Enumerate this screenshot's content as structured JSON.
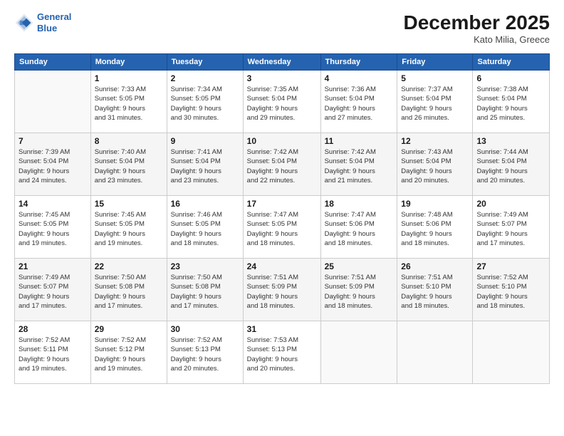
{
  "logo": {
    "line1": "General",
    "line2": "Blue"
  },
  "title": "December 2025",
  "subtitle": "Kato Milia, Greece",
  "header_days": [
    "Sunday",
    "Monday",
    "Tuesday",
    "Wednesday",
    "Thursday",
    "Friday",
    "Saturday"
  ],
  "weeks": [
    [
      {
        "day": "",
        "info": ""
      },
      {
        "day": "1",
        "info": "Sunrise: 7:33 AM\nSunset: 5:05 PM\nDaylight: 9 hours\nand 31 minutes."
      },
      {
        "day": "2",
        "info": "Sunrise: 7:34 AM\nSunset: 5:05 PM\nDaylight: 9 hours\nand 30 minutes."
      },
      {
        "day": "3",
        "info": "Sunrise: 7:35 AM\nSunset: 5:04 PM\nDaylight: 9 hours\nand 29 minutes."
      },
      {
        "day": "4",
        "info": "Sunrise: 7:36 AM\nSunset: 5:04 PM\nDaylight: 9 hours\nand 27 minutes."
      },
      {
        "day": "5",
        "info": "Sunrise: 7:37 AM\nSunset: 5:04 PM\nDaylight: 9 hours\nand 26 minutes."
      },
      {
        "day": "6",
        "info": "Sunrise: 7:38 AM\nSunset: 5:04 PM\nDaylight: 9 hours\nand 25 minutes."
      }
    ],
    [
      {
        "day": "7",
        "info": "Sunrise: 7:39 AM\nSunset: 5:04 PM\nDaylight: 9 hours\nand 24 minutes."
      },
      {
        "day": "8",
        "info": "Sunrise: 7:40 AM\nSunset: 5:04 PM\nDaylight: 9 hours\nand 23 minutes."
      },
      {
        "day": "9",
        "info": "Sunrise: 7:41 AM\nSunset: 5:04 PM\nDaylight: 9 hours\nand 23 minutes."
      },
      {
        "day": "10",
        "info": "Sunrise: 7:42 AM\nSunset: 5:04 PM\nDaylight: 9 hours\nand 22 minutes."
      },
      {
        "day": "11",
        "info": "Sunrise: 7:42 AM\nSunset: 5:04 PM\nDaylight: 9 hours\nand 21 minutes."
      },
      {
        "day": "12",
        "info": "Sunrise: 7:43 AM\nSunset: 5:04 PM\nDaylight: 9 hours\nand 20 minutes."
      },
      {
        "day": "13",
        "info": "Sunrise: 7:44 AM\nSunset: 5:04 PM\nDaylight: 9 hours\nand 20 minutes."
      }
    ],
    [
      {
        "day": "14",
        "info": "Sunrise: 7:45 AM\nSunset: 5:05 PM\nDaylight: 9 hours\nand 19 minutes."
      },
      {
        "day": "15",
        "info": "Sunrise: 7:45 AM\nSunset: 5:05 PM\nDaylight: 9 hours\nand 19 minutes."
      },
      {
        "day": "16",
        "info": "Sunrise: 7:46 AM\nSunset: 5:05 PM\nDaylight: 9 hours\nand 18 minutes."
      },
      {
        "day": "17",
        "info": "Sunrise: 7:47 AM\nSunset: 5:05 PM\nDaylight: 9 hours\nand 18 minutes."
      },
      {
        "day": "18",
        "info": "Sunrise: 7:47 AM\nSunset: 5:06 PM\nDaylight: 9 hours\nand 18 minutes."
      },
      {
        "day": "19",
        "info": "Sunrise: 7:48 AM\nSunset: 5:06 PM\nDaylight: 9 hours\nand 18 minutes."
      },
      {
        "day": "20",
        "info": "Sunrise: 7:49 AM\nSunset: 5:07 PM\nDaylight: 9 hours\nand 17 minutes."
      }
    ],
    [
      {
        "day": "21",
        "info": "Sunrise: 7:49 AM\nSunset: 5:07 PM\nDaylight: 9 hours\nand 17 minutes."
      },
      {
        "day": "22",
        "info": "Sunrise: 7:50 AM\nSunset: 5:08 PM\nDaylight: 9 hours\nand 17 minutes."
      },
      {
        "day": "23",
        "info": "Sunrise: 7:50 AM\nSunset: 5:08 PM\nDaylight: 9 hours\nand 17 minutes."
      },
      {
        "day": "24",
        "info": "Sunrise: 7:51 AM\nSunset: 5:09 PM\nDaylight: 9 hours\nand 18 minutes."
      },
      {
        "day": "25",
        "info": "Sunrise: 7:51 AM\nSunset: 5:09 PM\nDaylight: 9 hours\nand 18 minutes."
      },
      {
        "day": "26",
        "info": "Sunrise: 7:51 AM\nSunset: 5:10 PM\nDaylight: 9 hours\nand 18 minutes."
      },
      {
        "day": "27",
        "info": "Sunrise: 7:52 AM\nSunset: 5:10 PM\nDaylight: 9 hours\nand 18 minutes."
      }
    ],
    [
      {
        "day": "28",
        "info": "Sunrise: 7:52 AM\nSunset: 5:11 PM\nDaylight: 9 hours\nand 19 minutes."
      },
      {
        "day": "29",
        "info": "Sunrise: 7:52 AM\nSunset: 5:12 PM\nDaylight: 9 hours\nand 19 minutes."
      },
      {
        "day": "30",
        "info": "Sunrise: 7:52 AM\nSunset: 5:13 PM\nDaylight: 9 hours\nand 20 minutes."
      },
      {
        "day": "31",
        "info": "Sunrise: 7:53 AM\nSunset: 5:13 PM\nDaylight: 9 hours\nand 20 minutes."
      },
      {
        "day": "",
        "info": ""
      },
      {
        "day": "",
        "info": ""
      },
      {
        "day": "",
        "info": ""
      }
    ]
  ]
}
